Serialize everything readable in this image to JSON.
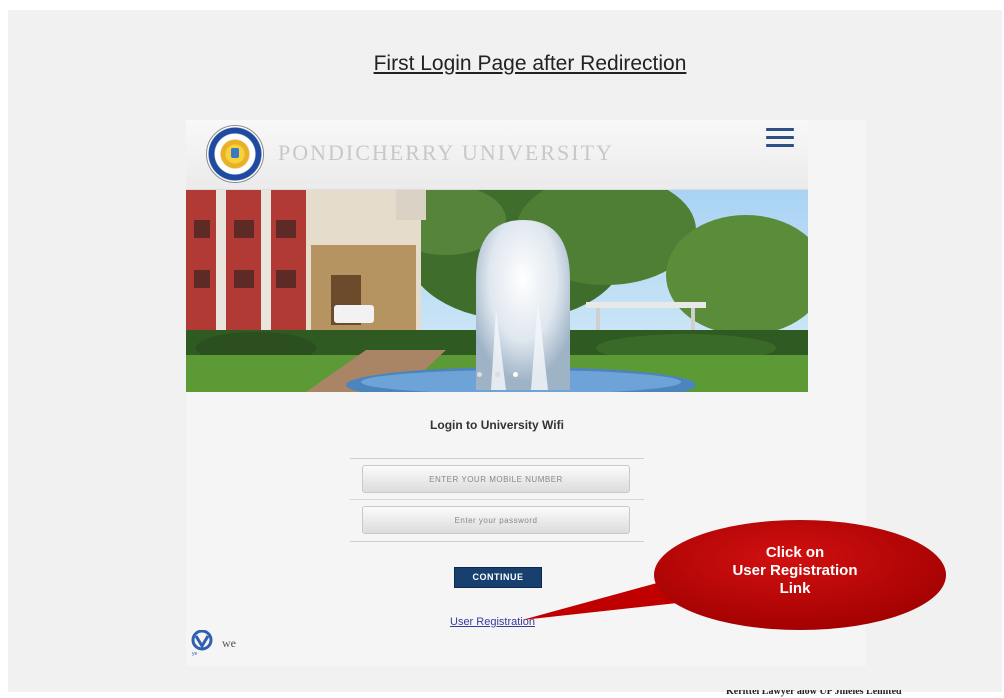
{
  "slide": {
    "title": "First Login Page after Redirection",
    "footer_text": "Kerittel Lawyer alow UP Jmeles Lemited"
  },
  "site": {
    "university_name": "Pondicherry University",
    "menu_icon": "hamburger-menu-icon",
    "logo_icon": "university-seal-icon"
  },
  "hero": {
    "carousel_dots": 3,
    "active_dot": 2
  },
  "login": {
    "heading": "Login to University Wifi",
    "mobile_placeholder": "ENTER YOUR MOBILE NUMBER",
    "password_placeholder": "Enter your password",
    "continue_label": "CONTINUE",
    "user_registration_label": "User Registration"
  },
  "footer": {
    "logo2_text": "we",
    "logo1_icon": "ye-logo-icon"
  },
  "callout": {
    "line1": "Click on",
    "line2": "User Registration",
    "line3": "Link",
    "color": "#c00000"
  }
}
